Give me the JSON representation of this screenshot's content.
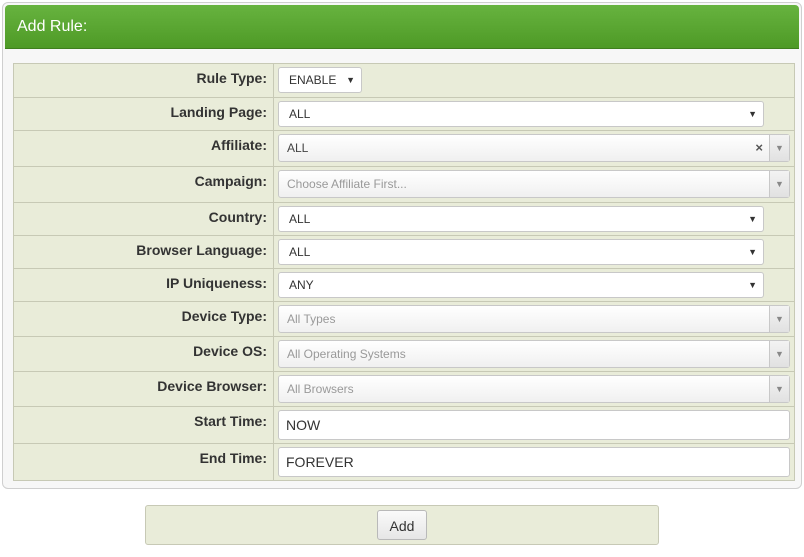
{
  "header": {
    "title": "Add Rule:"
  },
  "rows": {
    "rule_type": {
      "label": "Rule Type:",
      "value": "ENABLE"
    },
    "landing_page": {
      "label": "Landing Page:",
      "value": "ALL"
    },
    "affiliate": {
      "label": "Affiliate:",
      "value": "ALL",
      "clear": "×"
    },
    "campaign": {
      "label": "Campaign:",
      "placeholder": "Choose Affiliate First..."
    },
    "country": {
      "label": "Country:",
      "value": "ALL"
    },
    "browser_language": {
      "label": "Browser Language:",
      "value": "ALL"
    },
    "ip_uniqueness": {
      "label": "IP Uniqueness:",
      "value": "ANY"
    },
    "device_type": {
      "label": "Device Type:",
      "placeholder": "All Types"
    },
    "device_os": {
      "label": "Device OS:",
      "placeholder": "All Operating Systems"
    },
    "device_browser": {
      "label": "Device Browser:",
      "placeholder": "All Browsers"
    },
    "start_time": {
      "label": "Start Time:",
      "value": "NOW"
    },
    "end_time": {
      "label": "End Time:",
      "value": "FOREVER"
    }
  },
  "footer": {
    "add_label": "Add"
  },
  "icons": {
    "dropdown": "chevron-down-icon",
    "clear": "close-icon"
  },
  "colors": {
    "header_green": "#55a32d",
    "form_bg": "#e9ecd9",
    "panel_border": "#cfcfcf"
  }
}
